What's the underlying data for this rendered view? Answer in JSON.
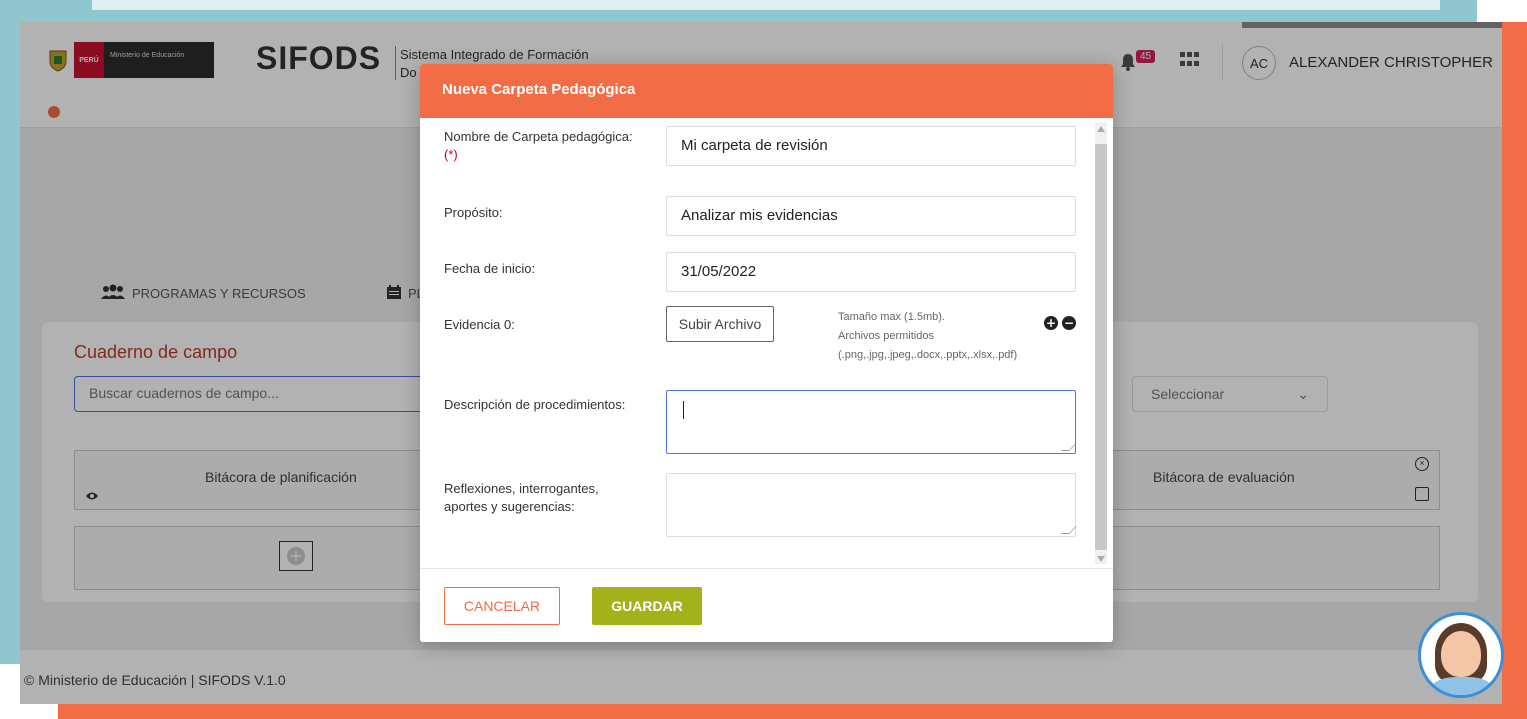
{
  "header": {
    "logo_peru": "PERÚ",
    "logo_ministry": "Ministerio de Educación",
    "brand": "SIFODS",
    "brand_subtitle_line1": "Sistema Integrado de Formación",
    "brand_subtitle_line2": "Do",
    "notifications_count": "45",
    "user_initials": "AC",
    "user_name": "ALEXANDER CHRISTOPHER"
  },
  "nav_tabs": {
    "programs": "PROGRAMAS Y RECURSOS",
    "planning": "PLA"
  },
  "notebook": {
    "title": "Cuaderno de campo",
    "search_placeholder": "Buscar cuadernos de campo...",
    "select_value": "Seleccionar",
    "col_planning": "Bitácora de planificación",
    "col_evaluation": "Bitácora de evaluación"
  },
  "modal": {
    "title": "Nueva Carpeta Pedagógica",
    "name_label": "Nombre de Carpeta pedagógica:",
    "required_mark": "(*)",
    "name_value": "Mi carpeta de revisión",
    "purpose_label": "Propósito:",
    "purpose_value": "Analizar mis evidencias",
    "start_date_label": "Fecha de inicio:",
    "start_date_value": "31/05/2022",
    "evidence_label": "Evidencia 0:",
    "upload_label": "Subir Archivo",
    "file_hint_size": "Tamaño max (1.5mb).",
    "file_hint_allowed": "Archivos permitidos",
    "file_hint_types": "(.png,.jpg,.jpeg,.docx,.pptx,.xlsx,.pdf)",
    "procedures_label": "Descripción de procedimientos:",
    "procedures_value": "",
    "reflections_label": "Reflexiones, interrogantes, aportes y sugerencias:",
    "reflections_value": "",
    "cancel_label": "CANCELAR",
    "save_label": "GUARDAR"
  },
  "footer": {
    "text": "© Ministerio de Educación | SIFODS V.1.0"
  },
  "icons": {
    "bell": "bell-icon",
    "apps": "grid-icon",
    "users": "users-icon",
    "calendar": "calendar-icon",
    "view": "eye-icon",
    "close": "close-circle-icon",
    "edit": "edit-icon",
    "add": "plus-circle-icon",
    "remove": "minus-circle-icon"
  },
  "colors": {
    "accent_orange": "#f26c45",
    "save_green": "#a3b11b",
    "required_red": "#d0021b",
    "frame_blue": "#90c7cf"
  }
}
